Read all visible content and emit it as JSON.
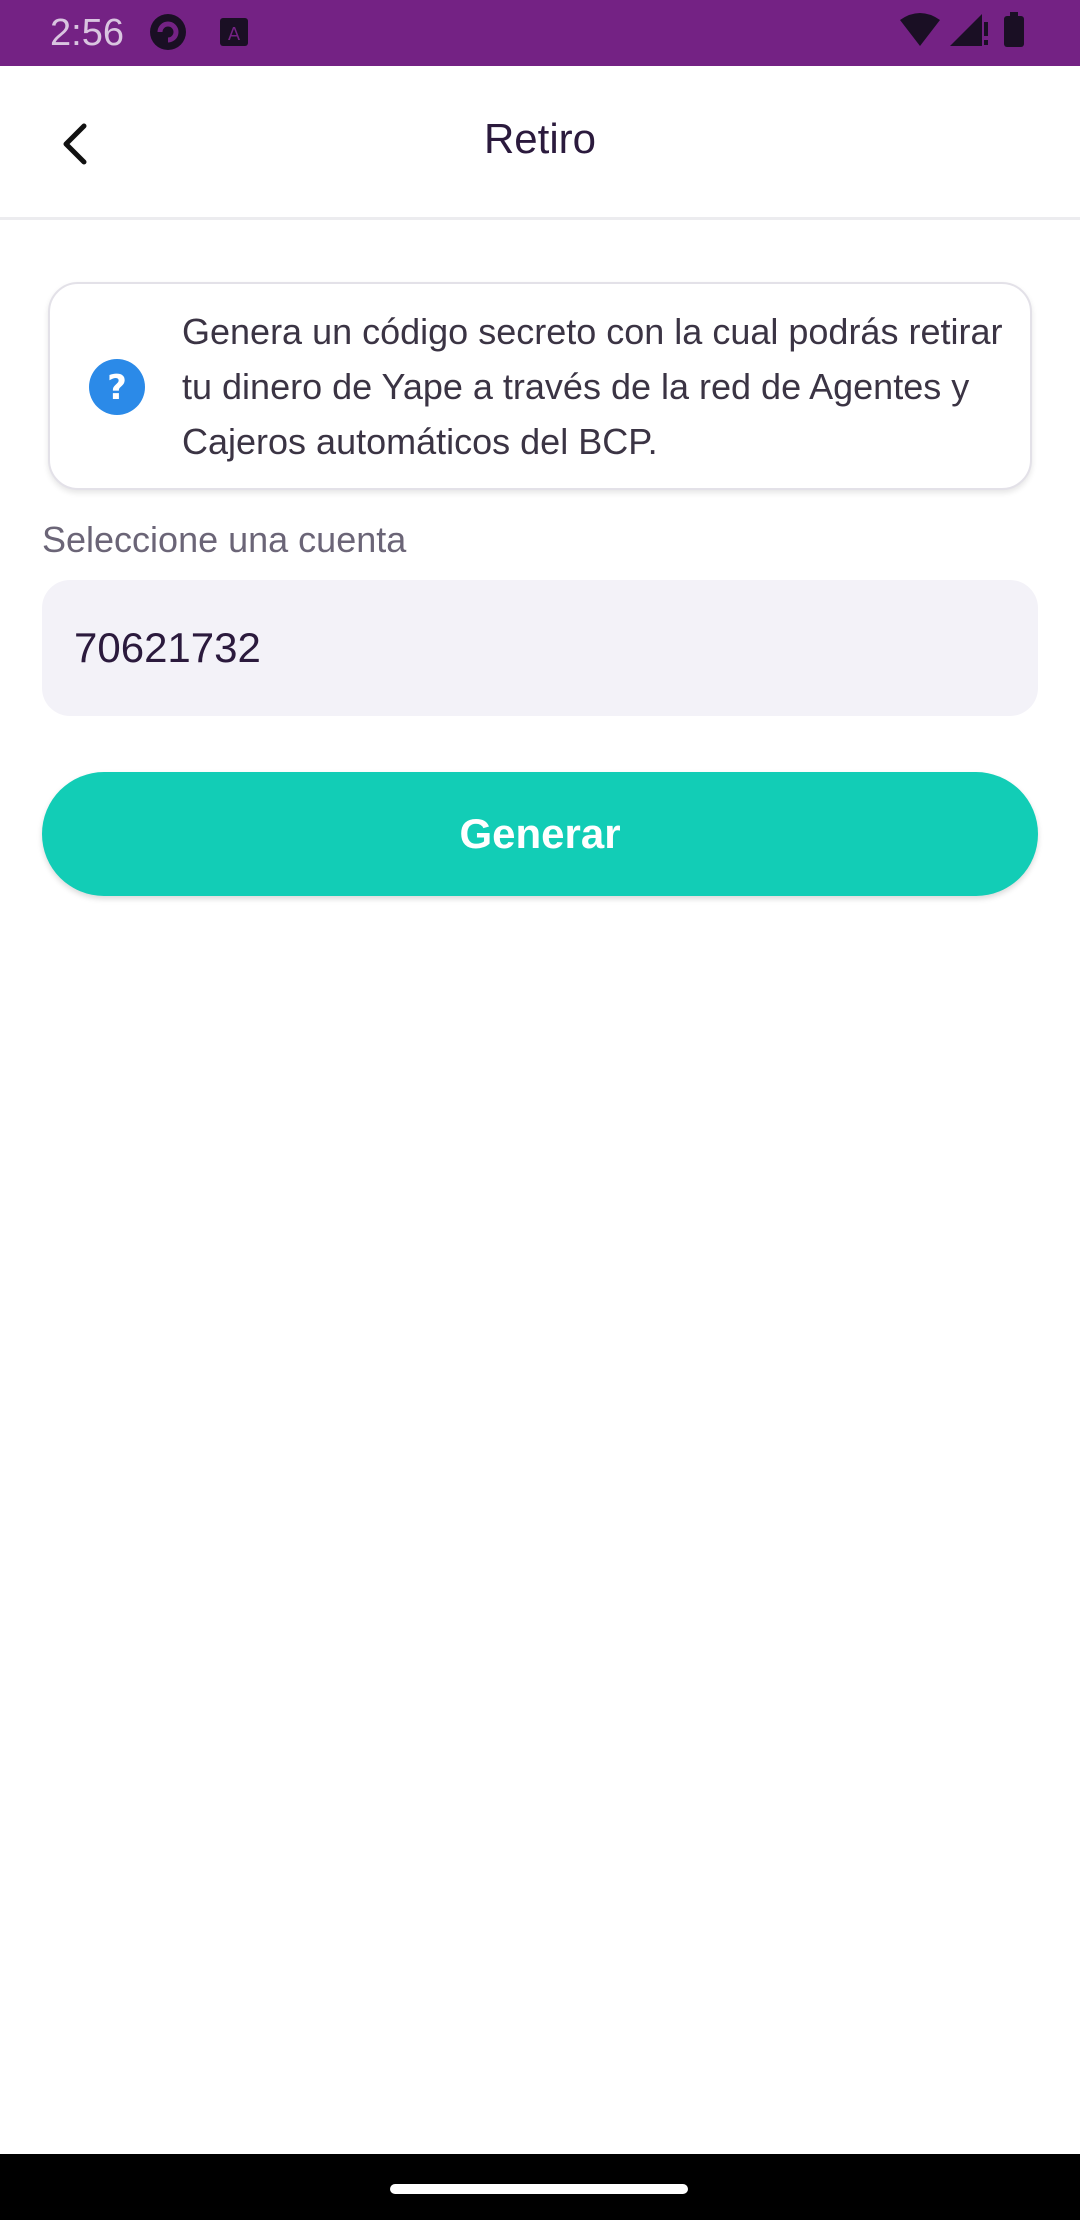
{
  "status_bar": {
    "time": "2:56",
    "background_color": "#742284",
    "icons": [
      "app-notification-icon",
      "text-notification-icon",
      "wifi-icon",
      "signal-icon",
      "battery-icon"
    ]
  },
  "header": {
    "title": "Retiro",
    "back_icon": "chevron-left-icon"
  },
  "info_card": {
    "icon": "help-circle-icon",
    "text": "Genera un código secreto con la cual podrás retirar tu dinero de Yape a través de la red de Agentes y Cajeros automáticos del BCP."
  },
  "account_select": {
    "label": "Seleccione una cuenta",
    "selected_value": "70621732"
  },
  "actions": {
    "generate_label": "Generar",
    "accent_color": "#12cdb6"
  }
}
